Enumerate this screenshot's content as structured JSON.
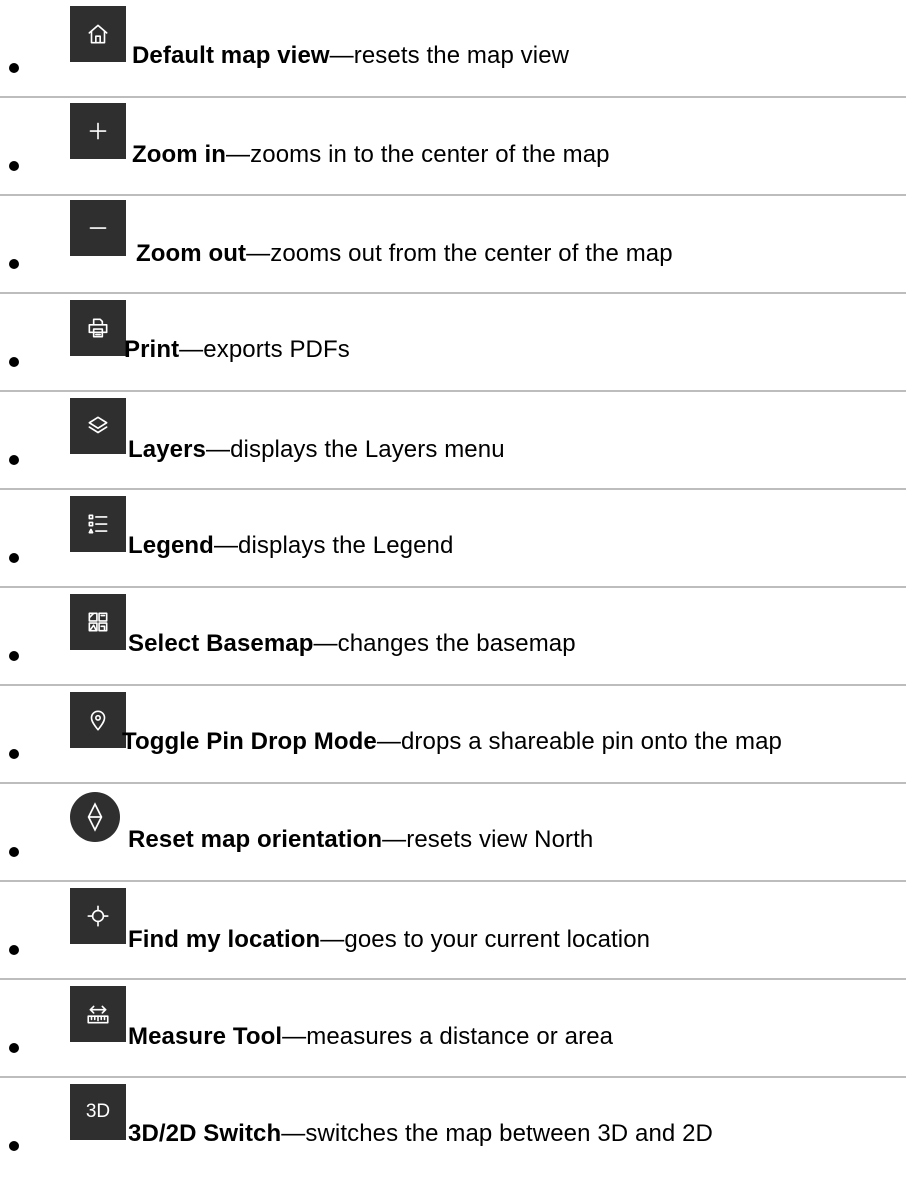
{
  "items": [
    {
      "icon": "home-icon",
      "title": "Default map view",
      "separator": "—",
      "text": "resets the map view"
    },
    {
      "icon": "plus-icon",
      "title": "Zoom in",
      "separator": "—",
      "text": "zooms in to the center of the map"
    },
    {
      "icon": "minus-icon",
      "title": "Zoom out",
      "separator": "—",
      "text": "zooms out from the center of the map"
    },
    {
      "icon": "printer-icon",
      "title": "Print",
      "separator": "—",
      "text": "exports PDFs"
    },
    {
      "icon": "layers-icon",
      "title": "Layers",
      "separator": "—",
      "text": "displays the Layers menu"
    },
    {
      "icon": "legend-icon",
      "title": "Legend",
      "separator": "—",
      "text": "displays the Legend"
    },
    {
      "icon": "basemap-gallery-icon",
      "title": "Select Basemap",
      "separator": "—",
      "text": "changes the basemap"
    },
    {
      "icon": "pin-icon",
      "title": "Toggle Pin Drop Mode",
      "separator": "—",
      "text": "drops a shareable pin onto the map"
    },
    {
      "icon": "compass-icon",
      "title": "Reset map orientation",
      "separator": "—",
      "text": "resets view North"
    },
    {
      "icon": "locate-crosshair-icon",
      "title": "Find my location",
      "separator": "—",
      "text": "goes to your current location"
    },
    {
      "icon": "measure-ruler-icon",
      "title": "Measure Tool",
      "separator": "—",
      "text": "measures a distance or area"
    },
    {
      "icon": "3d-2d-switch-icon",
      "title": "3D/2D Switch",
      "separator": "—",
      "text": "switches the map between 3D and 2D",
      "icon_label": "3D"
    }
  ]
}
